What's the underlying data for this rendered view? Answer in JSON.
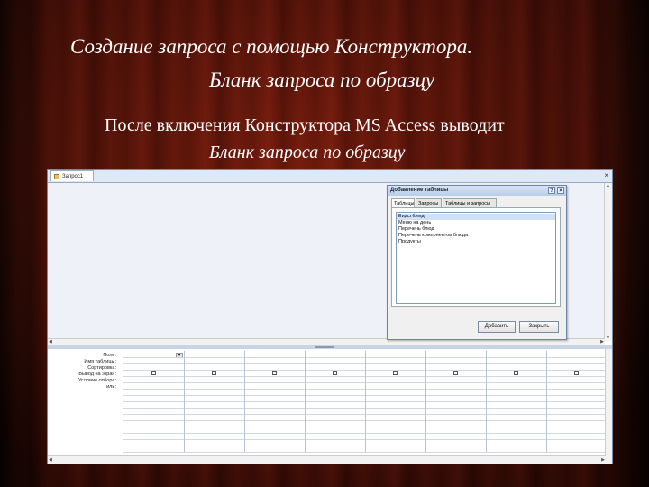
{
  "slide": {
    "title_line1": "Создание запроса с помощью Конструктора.",
    "title_line2": "Бланк запроса по образцу",
    "body_line1": "После включения Конструктора MS Access выводит",
    "body_line2": "Бланк запроса по образцу"
  },
  "access": {
    "doc_tab": "Запрос1",
    "close_glyph": "×",
    "dialog": {
      "title": "Добавление таблицы",
      "help_glyph": "?",
      "close_glyph": "×",
      "tabs": [
        "Таблицы",
        "Запросы",
        "Таблицы и запросы"
      ],
      "active_tab": 0,
      "items": [
        "Виды блюд",
        "Меню на день",
        "Перечень блюд",
        "Перечень компонентов блюда",
        "Продукты"
      ],
      "selected_index": 0,
      "add_button": "Добавить",
      "close_button": "Закрыть"
    },
    "qbe": {
      "row_labels": [
        "Поле:",
        "Имя таблицы:",
        "Сортировка:",
        "Вывод на экран:",
        "Условие отбора:",
        "или:"
      ],
      "column_count": 8
    }
  },
  "colors": {
    "curtain_red": "#6e180b",
    "title_text": "#ffffff"
  }
}
